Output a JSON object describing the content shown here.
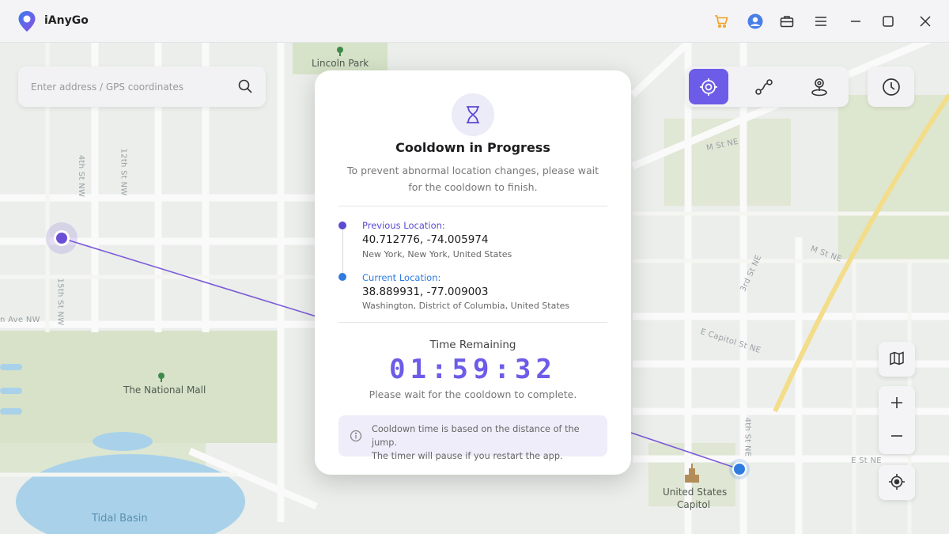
{
  "app": {
    "title": "iAnyGo",
    "brand_color": "#6c5ce7",
    "icons": [
      "cart-icon",
      "user-icon",
      "toolbox-icon",
      "menu-icon",
      "minimize-icon",
      "maximize-icon",
      "close-icon"
    ]
  },
  "search": {
    "placeholder": "Enter address / GPS coordinates"
  },
  "map": {
    "place_labels": [
      "Lincoln Park",
      "The National Mall",
      "Tidal Basin",
      "United States",
      "Capitol"
    ],
    "street_labels": [
      "M St NE",
      "M St NE",
      "3rd St NE",
      "E Capitol St NE",
      "E St NE",
      "4th St NW",
      "12th St NW",
      "15th St NW",
      "n Ave NW",
      "4th St NE"
    ]
  },
  "modes": [
    {
      "name": "teleport-mode",
      "icon": "crosshair-target-icon",
      "active": true
    },
    {
      "name": "route-mode",
      "icon": "route-icon",
      "active": false
    },
    {
      "name": "joystick-mode",
      "icon": "joystick-icon",
      "active": false
    }
  ],
  "dialog": {
    "title": "Cooldown in Progress",
    "description": "To prevent abnormal location changes, please wait for the cooldown to finish.",
    "previous": {
      "label": "Previous Location:",
      "coords": "40.712776, -74.005974",
      "address": "New York, New York, United States",
      "color": "#5b4bd1"
    },
    "current": {
      "label": "Current Location:",
      "coords": "38.889931, -77.009003",
      "address": "Washington, District of Columbia, United States",
      "color": "#2f7be0"
    },
    "time_label": "Time Remaining",
    "timer": "01:59:32",
    "wait_text": "Please wait for the cooldown to complete.",
    "info_line1": "Cooldown time is based on the distance of the jump.",
    "info_line2": "The timer will pause if you restart the app."
  }
}
